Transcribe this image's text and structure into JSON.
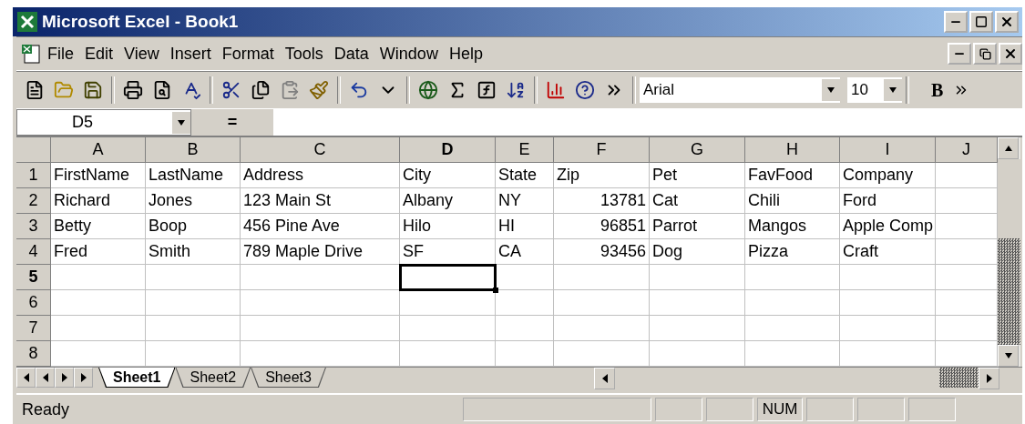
{
  "window": {
    "title": "Microsoft Excel - Book1"
  },
  "menu": [
    {
      "label": "File"
    },
    {
      "label": "Edit"
    },
    {
      "label": "View"
    },
    {
      "label": "Insert"
    },
    {
      "label": "Format"
    },
    {
      "label": "Tools"
    },
    {
      "label": "Data"
    },
    {
      "label": "Window"
    },
    {
      "label": "Help"
    }
  ],
  "toolbar": {
    "font": "Arial",
    "size": "10",
    "bold_label": "B"
  },
  "formula_bar": {
    "name_box": "D5",
    "equals": "="
  },
  "columns": [
    {
      "label": "A",
      "selected": false
    },
    {
      "label": "B",
      "selected": false
    },
    {
      "label": "C",
      "selected": false
    },
    {
      "label": "D",
      "selected": true
    },
    {
      "label": "E",
      "selected": false
    },
    {
      "label": "F",
      "selected": false
    },
    {
      "label": "G",
      "selected": false
    },
    {
      "label": "H",
      "selected": false
    },
    {
      "label": "I",
      "selected": false
    },
    {
      "label": "J",
      "selected": false
    }
  ],
  "rows": [
    {
      "label": "1",
      "selected": false,
      "cells": [
        {
          "kind": "text",
          "text": "FirstName"
        },
        {
          "kind": "text",
          "text": "LastName"
        },
        {
          "kind": "text",
          "text": "Address"
        },
        {
          "kind": "text",
          "text": "City"
        },
        {
          "kind": "text",
          "text": "State"
        },
        {
          "kind": "text",
          "text": "Zip"
        },
        {
          "kind": "text",
          "text": "Pet"
        },
        {
          "kind": "text",
          "text": "FavFood"
        },
        {
          "kind": "text",
          "text": "Company"
        }
      ]
    },
    {
      "label": "2",
      "selected": false,
      "cells": [
        {
          "kind": "text",
          "text": "Richard"
        },
        {
          "kind": "text",
          "text": "Jones"
        },
        {
          "kind": "text",
          "text": "123 Main St"
        },
        {
          "kind": "text",
          "text": "Albany"
        },
        {
          "kind": "text",
          "text": "NY"
        },
        {
          "kind": "number",
          "text": "13781"
        },
        {
          "kind": "text",
          "text": "Cat"
        },
        {
          "kind": "text",
          "text": "Chili"
        },
        {
          "kind": "text",
          "text": "Ford"
        }
      ]
    },
    {
      "label": "3",
      "selected": false,
      "cells": [
        {
          "kind": "text",
          "text": "Betty"
        },
        {
          "kind": "text",
          "text": "Boop"
        },
        {
          "kind": "text",
          "text": "456 Pine Ave"
        },
        {
          "kind": "text",
          "text": "Hilo"
        },
        {
          "kind": "text",
          "text": "HI"
        },
        {
          "kind": "number",
          "text": "96851"
        },
        {
          "kind": "text",
          "text": "Parrot"
        },
        {
          "kind": "text",
          "text": "Mangos"
        },
        {
          "kind": "text",
          "text": "Apple Comp"
        }
      ]
    },
    {
      "label": "4",
      "selected": false,
      "cells": [
        {
          "kind": "text",
          "text": "Fred"
        },
        {
          "kind": "text",
          "text": "Smith"
        },
        {
          "kind": "text",
          "text": "789 Maple Drive"
        },
        {
          "kind": "text",
          "text": "SF"
        },
        {
          "kind": "text",
          "text": "CA"
        },
        {
          "kind": "number",
          "text": "93456"
        },
        {
          "kind": "text",
          "text": "Dog"
        },
        {
          "kind": "text",
          "text": "Pizza"
        },
        {
          "kind": "text",
          "text": "Craft"
        }
      ]
    },
    {
      "label": "5",
      "selected": true,
      "cells": []
    },
    {
      "label": "6",
      "selected": false,
      "cells": []
    },
    {
      "label": "7",
      "selected": false,
      "cells": []
    },
    {
      "label": "8",
      "selected": false,
      "cells": []
    }
  ],
  "sheets": [
    {
      "label": "Sheet1",
      "selected": true
    },
    {
      "label": "Sheet2",
      "selected": false
    },
    {
      "label": "Sheet3",
      "selected": false
    }
  ],
  "status_bar": {
    "text": "Ready",
    "indicators": [
      {
        "kind": "empty"
      },
      {
        "kind": "empty"
      },
      {
        "kind": "empty"
      },
      {
        "kind": "text",
        "label": "NUM"
      },
      {
        "kind": "empty"
      },
      {
        "kind": "empty"
      },
      {
        "kind": "empty"
      }
    ]
  }
}
